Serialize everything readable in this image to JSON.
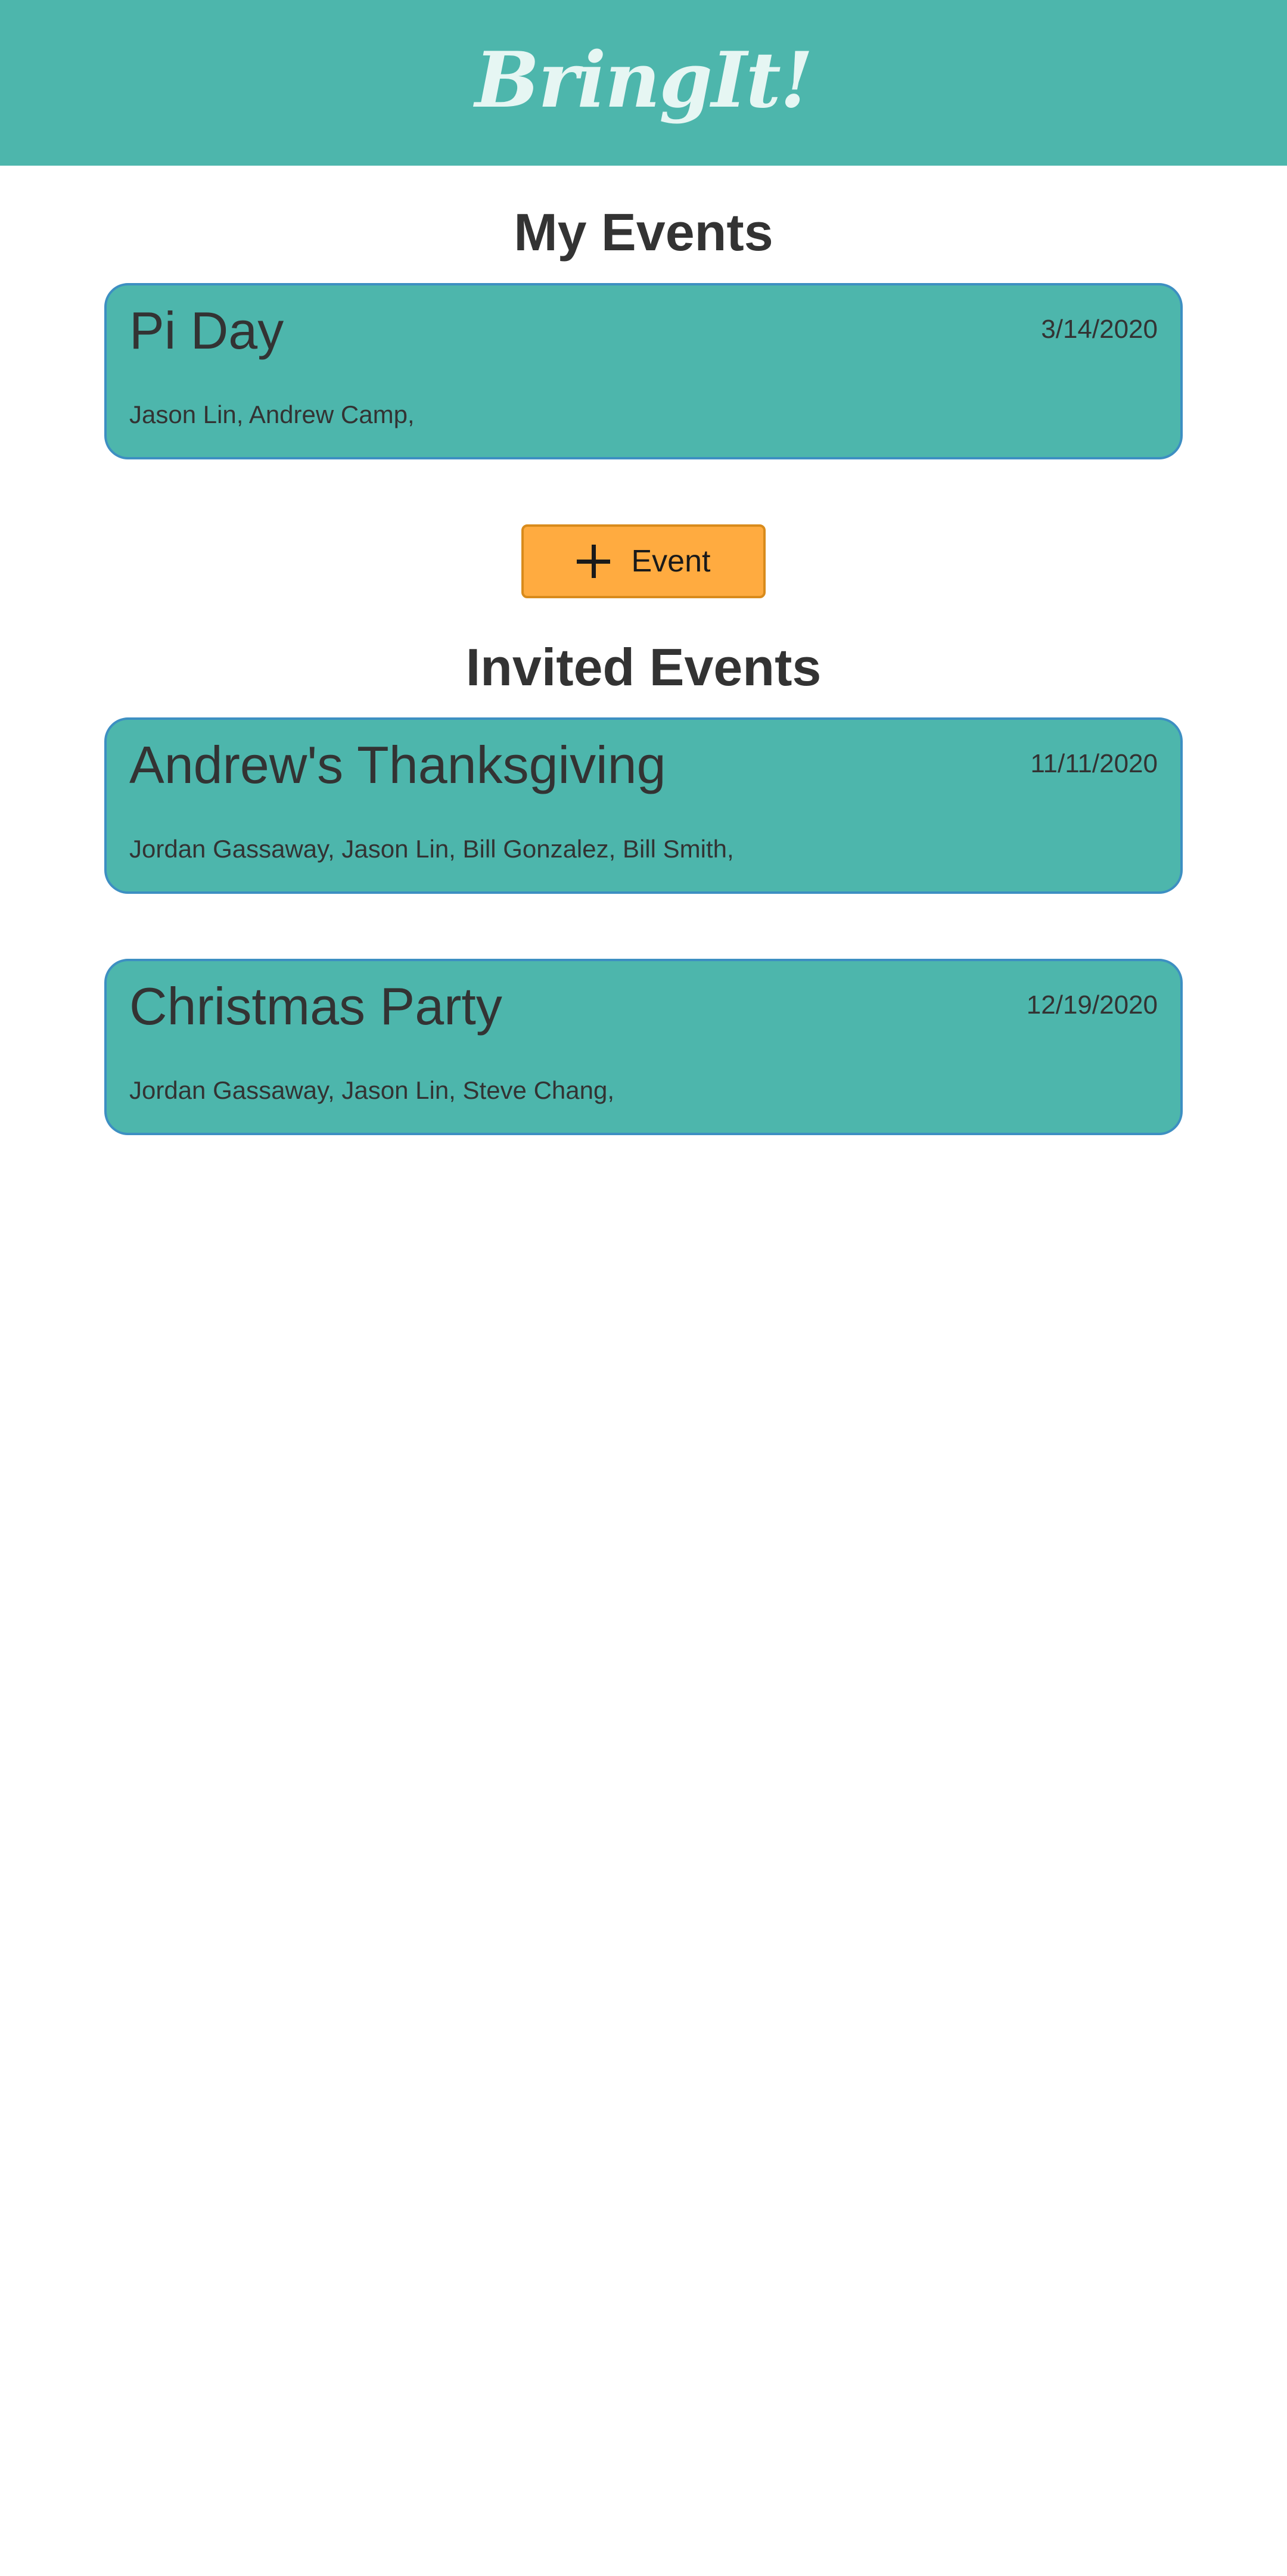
{
  "header": {
    "logo_text": "BringIt!"
  },
  "my_events": {
    "title": "My Events",
    "items": [
      {
        "name": "Pi Day",
        "date": "3/14/2020",
        "guests": "Jason Lin, Andrew Camp,"
      }
    ]
  },
  "add_button": {
    "icon": "plus-icon",
    "label": "Event"
  },
  "invited_events": {
    "title": "Invited Events",
    "items": [
      {
        "name": "Andrew's Thanksgiving",
        "date": "11/11/2020",
        "guests": "Jordan Gassaway, Jason Lin, Bill Gonzalez, Bill Smith,"
      },
      {
        "name": "Christmas Party",
        "date": "12/19/2020",
        "guests": "Jordan Gassaway, Jason Lin, Steve Chang,"
      }
    ]
  },
  "colors": {
    "header_bg": "#4db6ac",
    "card_bg": "#4db6ac",
    "card_border": "#3d8fc2",
    "button_bg": "#ffab40",
    "button_border": "#d98b1c",
    "text": "#333333"
  }
}
